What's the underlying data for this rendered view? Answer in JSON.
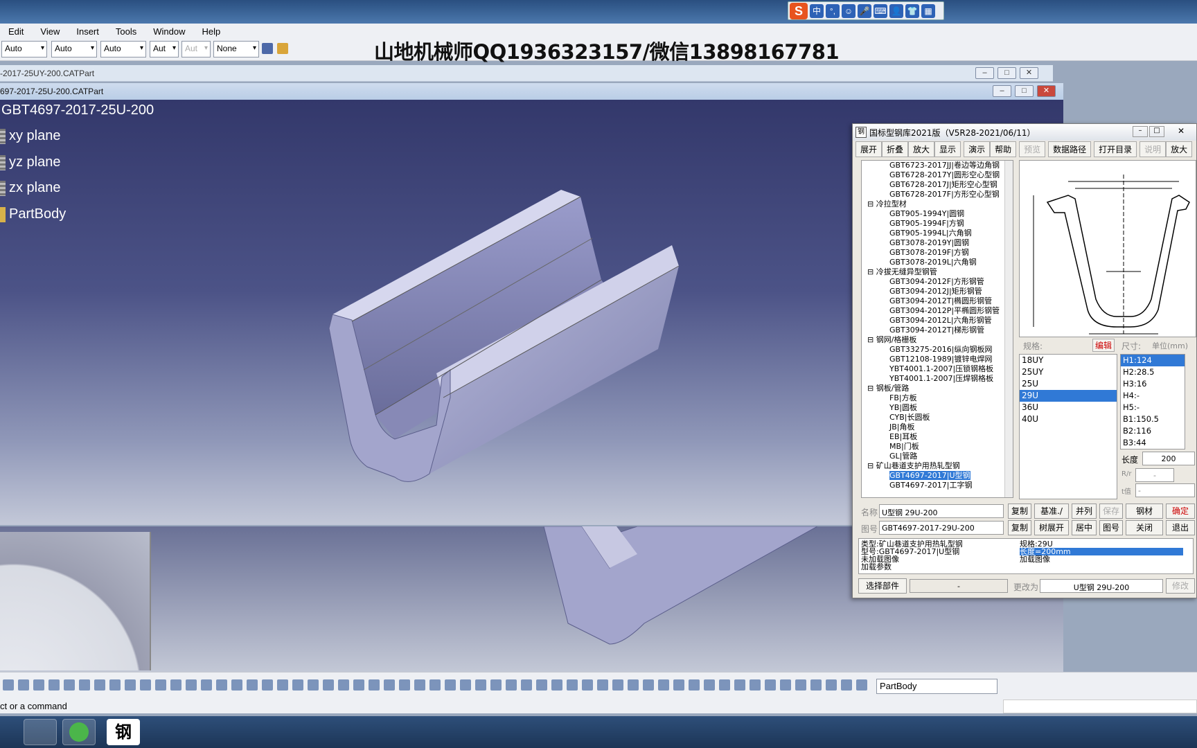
{
  "menu": [
    "Edit",
    "View",
    "Insert",
    "Tools",
    "Window",
    "Help"
  ],
  "toolbar_combos": [
    "Auto",
    "Auto",
    "Auto",
    "Aut",
    "Aut",
    "None"
  ],
  "watermark": "山地机械师QQ1936323157/微信13898167781",
  "windows": {
    "back_title": "-2017-25UY-200.CATPart",
    "front_title": "697-2017-25U-200.CATPart"
  },
  "spec_tree": {
    "root": "GBT4697-2017-25U-200",
    "items": [
      "xy plane",
      "yz plane",
      "zx plane",
      "PartBody"
    ]
  },
  "ime": {
    "logo": "S",
    "items": [
      "中",
      "°,",
      "☺",
      "🎤",
      "⌨",
      "👤",
      "👕",
      "▦"
    ]
  },
  "dialog": {
    "title": "国标型钢库2021版（V5R28-2021/06/11）",
    "icon": "钢",
    "toolbar": [
      "展开",
      "折叠",
      "放大",
      "显示",
      "演示",
      "帮助",
      "预览",
      "数据路径",
      "打开目录",
      "说明",
      "放大"
    ],
    "tree": [
      {
        "t": "GBT6723-2017JJ|卷边等边角钢",
        "k": "sub"
      },
      {
        "t": "GBT6728-2017Y|圆形空心型钢",
        "k": "sub"
      },
      {
        "t": "GBT6728-2017J|矩形空心型钢",
        "k": "sub"
      },
      {
        "t": "GBT6728-2017F|方形空心型钢",
        "k": "sub"
      },
      {
        "t": "⊟ 冷拉型材",
        "k": "cat"
      },
      {
        "t": "GBT905-1994Y|圆钢",
        "k": "sub"
      },
      {
        "t": "GBT905-1994F|方钢",
        "k": "sub"
      },
      {
        "t": "GBT905-1994L|六角钢",
        "k": "sub"
      },
      {
        "t": "GBT3078-2019Y|圆钢",
        "k": "sub"
      },
      {
        "t": "GBT3078-2019F|方钢",
        "k": "sub"
      },
      {
        "t": "GBT3078-2019L|六角钢",
        "k": "sub"
      },
      {
        "t": "⊟ 冷拔无缝异型钢管",
        "k": "cat"
      },
      {
        "t": "GBT3094-2012F|方形钢管",
        "k": "sub"
      },
      {
        "t": "GBT3094-2012J|矩形钢管",
        "k": "sub"
      },
      {
        "t": "GBT3094-2012T|椭圆形钢管",
        "k": "sub"
      },
      {
        "t": "GBT3094-2012P|平椭圆形钢管",
        "k": "sub"
      },
      {
        "t": "GBT3094-2012L|六角形钢管",
        "k": "sub"
      },
      {
        "t": "GBT3094-2012T|梯形钢管",
        "k": "sub"
      },
      {
        "t": "⊟ 钢网/格栅板",
        "k": "cat"
      },
      {
        "t": "GBT33275-2016|纵向钢板网",
        "k": "sub"
      },
      {
        "t": "GBT12108-1989|镀锌电焊网",
        "k": "sub"
      },
      {
        "t": "YBT4001.1-2007|压锁钢格板",
        "k": "sub"
      },
      {
        "t": "YBT4001.1-2007|压焊钢格板",
        "k": "sub"
      },
      {
        "t": "⊟ 钢板/管路",
        "k": "cat"
      },
      {
        "t": "FB|方板",
        "k": "sub"
      },
      {
        "t": "YB|圆板",
        "k": "sub"
      },
      {
        "t": "CYB|长圆板",
        "k": "sub"
      },
      {
        "t": "JB|角板",
        "k": "sub"
      },
      {
        "t": "EB|耳板",
        "k": "sub"
      },
      {
        "t": "MB|门板",
        "k": "sub"
      },
      {
        "t": "GL|管路",
        "k": "sub"
      },
      {
        "t": "⊟ 矿山巷道支护用热轧型钢",
        "k": "cat"
      },
      {
        "t": "GBT4697-2017|U型钢",
        "k": "sub sel"
      },
      {
        "t": "GBT4697-2017|工字钢",
        "k": "sub"
      }
    ],
    "spec_label": "规格:",
    "edit_label": "编辑",
    "size_label": "尺寸:",
    "unit_label": "单位(mm)",
    "specs": [
      "18UY",
      "25UY",
      "25U",
      "29U",
      "36U",
      "40U"
    ],
    "selected_spec_index": 3,
    "sizes": [
      "H1:124",
      "H2:28.5",
      "H3:16",
      "H4:-",
      "H5:-",
      "B1:150.5",
      "B2:116",
      "B3:44"
    ],
    "length_label": "长度",
    "length_value": "200",
    "rr_label": "R/r",
    "rr_value": "-",
    "t_label": "t值",
    "t_value": "-",
    "name_label": "名称",
    "name_value": "U型钢 29U-200",
    "drawno_label": "图号",
    "drawno_value": "GBT4697-2017-29U-200",
    "row1_buttons": [
      "复制",
      "基准./",
      "并列",
      "保存",
      "钢材",
      "确定"
    ],
    "row2_buttons": [
      "复制",
      "树展开",
      "居中",
      "图号",
      "关闭",
      "退出"
    ],
    "info_left": [
      "类型:矿山巷道支护用热轧型钢",
      "型号:GBT4697-2017|U型钢",
      "未加载图像",
      "加载参数"
    ],
    "info_right": [
      "规格:29U",
      "长度=200mm",
      "加载图像"
    ],
    "select_part": "选择部件",
    "dash_field": "-",
    "change_to_label": "更改为",
    "change_to_value": "U型钢 29U-200",
    "modify": "修改"
  },
  "bottom": {
    "part_combo": "PartBody",
    "status": "ct or a command"
  },
  "taskbar": {
    "apps": [
      "ie",
      "catia",
      "钢"
    ]
  }
}
